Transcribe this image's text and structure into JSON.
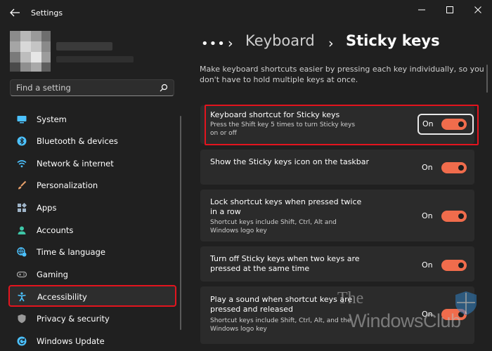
{
  "window": {
    "title": "Settings",
    "back_icon": "back-arrow-icon",
    "controls": [
      "minimize-icon",
      "maximize-icon",
      "close-icon"
    ]
  },
  "search": {
    "placeholder": "Find a setting",
    "icon": "search-icon"
  },
  "sidebar": {
    "items": [
      {
        "label": "System",
        "icon": "monitor-icon",
        "icon_color": "#4cc2ff"
      },
      {
        "label": "Bluetooth & devices",
        "icon": "bluetooth-icon",
        "icon_color": "#4cc2ff"
      },
      {
        "label": "Network & internet",
        "icon": "wifi-icon",
        "icon_color": "#4cc2ff"
      },
      {
        "label": "Personalization",
        "icon": "brush-icon",
        "icon_color": "#e8a06b"
      },
      {
        "label": "Apps",
        "icon": "apps-icon",
        "icon_color": "#9fb4c8"
      },
      {
        "label": "Accounts",
        "icon": "person-icon",
        "icon_color": "#3ec7a8"
      },
      {
        "label": "Time & language",
        "icon": "globe-clock-icon",
        "icon_color": "#4cc2ff"
      },
      {
        "label": "Gaming",
        "icon": "gamepad-icon",
        "icon_color": "#a8a8a8"
      },
      {
        "label": "Accessibility",
        "icon": "accessibility-icon",
        "icon_color": "#4cc2ff",
        "selected": true
      },
      {
        "label": "Privacy & security",
        "icon": "shield-icon",
        "icon_color": "#9a9a9a"
      },
      {
        "label": "Windows Update",
        "icon": "update-icon",
        "icon_color": "#4cc2ff"
      }
    ]
  },
  "breadcrumb": {
    "more": "•••",
    "separator": "›",
    "parent": "Keyboard",
    "current": "Sticky keys"
  },
  "description": "Make keyboard shortcuts easier by pressing each key individually, so you don't have to hold multiple keys at once.",
  "settings": [
    {
      "title": "Keyboard shortcut for Sticky keys",
      "subtitle": "Press the Shift key 5 times to turn Sticky keys on or off",
      "state": "On"
    },
    {
      "title": "Show the Sticky keys icon on the taskbar",
      "subtitle": "",
      "state": "On"
    },
    {
      "title": "Lock shortcut keys when pressed twice in a row",
      "subtitle": "Shortcut keys include Shift, Ctrl, Alt and Windows logo key",
      "state": "On"
    },
    {
      "title": "Turn off Sticky keys when two keys are pressed at the same time",
      "subtitle": "",
      "state": "On"
    },
    {
      "title": "Play a sound when shortcut keys are pressed and released",
      "subtitle": "Shortcut keys include Shift, Ctrl, Alt, and the Windows logo key",
      "state": "On"
    }
  ],
  "colors": {
    "accent_toggle": "#f06c4c",
    "highlight_border": "#e3141e",
    "background": "#202020",
    "card": "#2b2b2b"
  },
  "watermark": {
    "line1": "The",
    "line2": "WindowsClub"
  }
}
